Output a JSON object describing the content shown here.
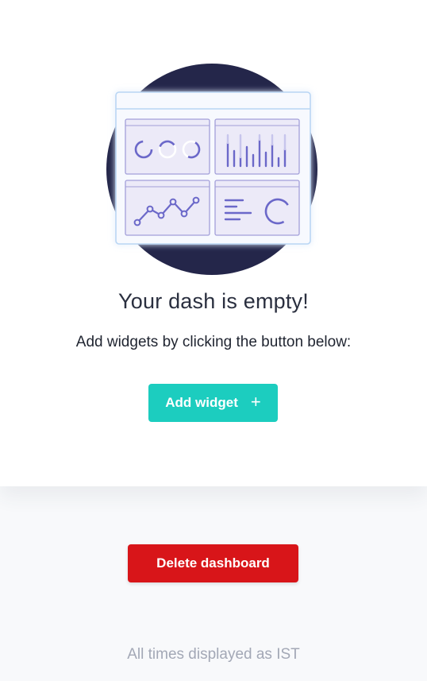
{
  "empty_state": {
    "illustration_icon": "dashboard-widgets-illustration",
    "title": "Your dash is empty!",
    "subtitle": "Add widgets by clicking the button below:",
    "add_button": {
      "label": "Add widget",
      "icon": "+"
    }
  },
  "footer": {
    "delete_button_label": "Delete dashboard",
    "timezone_note": "All times displayed as IST"
  },
  "colors": {
    "accent": "#1ccdbf",
    "danger": "#d81519",
    "illustration_circle": "#24264a",
    "illustration_stroke": "#6b68c9"
  }
}
